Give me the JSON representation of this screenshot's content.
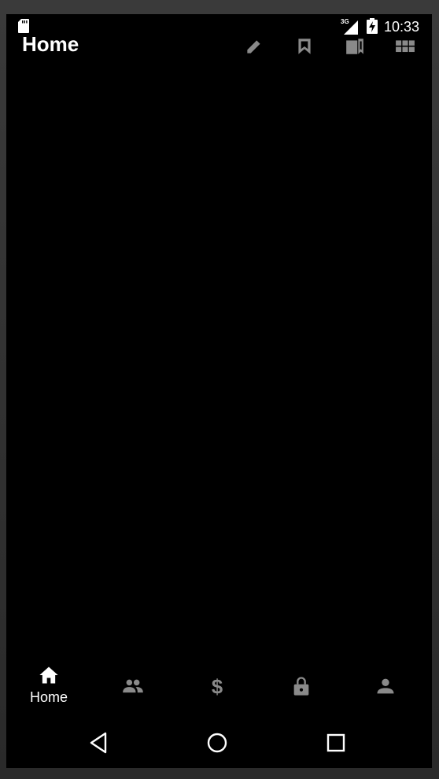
{
  "status_bar": {
    "network": "3G",
    "time": "10:33",
    "icons": [
      "sd-card-icon",
      "signal-icon",
      "battery-charging-icon"
    ]
  },
  "app_bar": {
    "title": "Home",
    "actions": [
      "edit-icon",
      "bookmark-icon",
      "saved-items-icon",
      "grid-view-icon"
    ]
  },
  "bottom_nav": {
    "items": [
      {
        "icon": "home-icon",
        "label": "Home",
        "selected": true
      },
      {
        "icon": "people-icon",
        "label": "",
        "selected": false
      },
      {
        "icon": "dollar-icon",
        "label": "",
        "selected": false
      },
      {
        "icon": "lock-icon",
        "label": "",
        "selected": false
      },
      {
        "icon": "person-icon",
        "label": "",
        "selected": false
      }
    ]
  },
  "system_nav": {
    "buttons": [
      "back-icon",
      "home-circle-icon",
      "recents-icon"
    ]
  },
  "colors": {
    "background": "#000000",
    "selected": "#ffffff",
    "unselected": "#8a8a8a"
  }
}
